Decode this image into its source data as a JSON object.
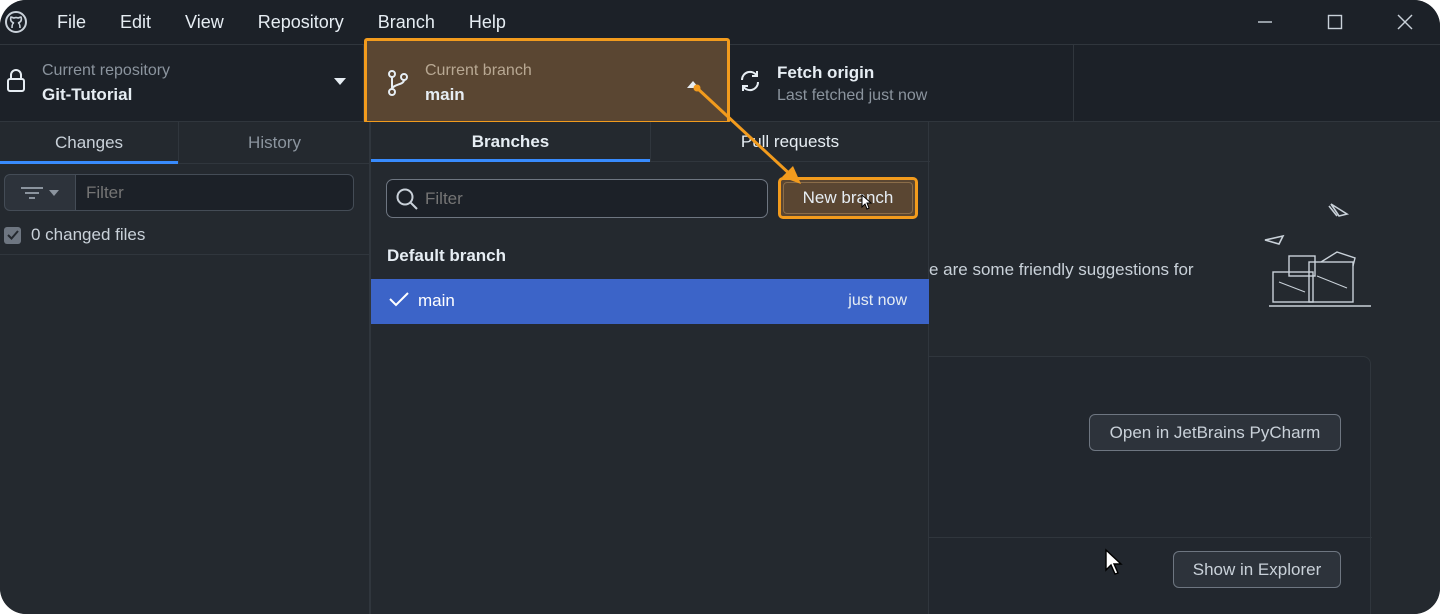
{
  "menu": {
    "items": [
      "File",
      "Edit",
      "View",
      "Repository",
      "Branch",
      "Help"
    ]
  },
  "toolbar": {
    "repo_label": "Current repository",
    "repo_name": "Git-Tutorial",
    "branch_label": "Current branch",
    "branch_name": "main",
    "fetch_title": "Fetch origin",
    "fetch_status": "Last fetched just now"
  },
  "sidebar": {
    "tabs": [
      "Changes",
      "History"
    ],
    "active_tab": "Changes",
    "filter_placeholder": "Filter",
    "changed_files": "0 changed files"
  },
  "branches_dropdown": {
    "tabs": [
      "Branches",
      "Pull requests"
    ],
    "active_tab": "Branches",
    "filter_placeholder": "Filter",
    "new_branch_label": "New branch",
    "default_heading": "Default branch",
    "branches": [
      {
        "name": "main",
        "time": "just now",
        "selected": true
      }
    ]
  },
  "main": {
    "suggestion_text": "e are some friendly suggestions for",
    "open_editor_label": "Open in JetBrains PyCharm",
    "show_explorer_label": "Show in Explorer"
  },
  "colors": {
    "highlight": "#f29b1d",
    "selected_row": "#3c64c8",
    "tab_accent": "#388bfd"
  }
}
